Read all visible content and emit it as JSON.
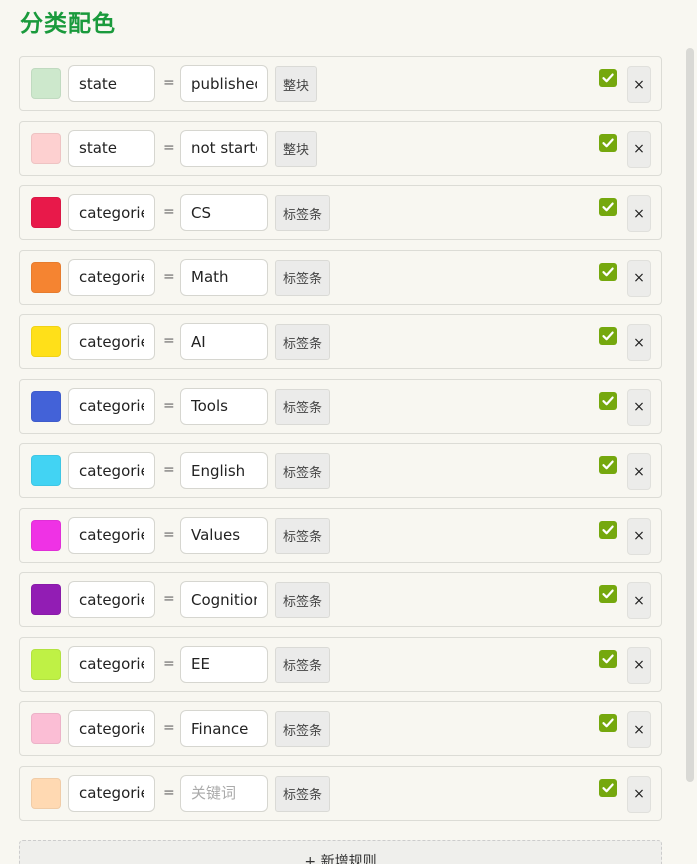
{
  "header": {
    "title": "分类配色"
  },
  "rules": [
    {
      "color": "#cde8cc",
      "key": "state",
      "value": "published",
      "placeholder": "",
      "mode": "整块",
      "enabled": true
    },
    {
      "color": "#fdd0d0",
      "key": "state",
      "value": "not started",
      "placeholder": "",
      "mode": "整块",
      "enabled": true
    },
    {
      "color": "#e8194a",
      "key": "categories",
      "value": "CS",
      "placeholder": "",
      "mode": "标签条",
      "enabled": true
    },
    {
      "color": "#f58431",
      "key": "categories",
      "value": "Math",
      "placeholder": "",
      "mode": "标签条",
      "enabled": true
    },
    {
      "color": "#ffe019",
      "key": "categories",
      "value": "AI",
      "placeholder": "",
      "mode": "标签条",
      "enabled": true
    },
    {
      "color": "#4362d8",
      "key": "categories",
      "value": "Tools",
      "placeholder": "",
      "mode": "标签条",
      "enabled": true
    },
    {
      "color": "#42d3f3",
      "key": "categories",
      "value": "English",
      "placeholder": "",
      "mode": "标签条",
      "enabled": true
    },
    {
      "color": "#ef32e5",
      "key": "categories",
      "value": "Values",
      "placeholder": "",
      "mode": "标签条",
      "enabled": true
    },
    {
      "color": "#921db4",
      "key": "categories",
      "value": "Cognition",
      "placeholder": "",
      "mode": "标签条",
      "enabled": true
    },
    {
      "color": "#bff145",
      "key": "categories",
      "value": "EE",
      "placeholder": "",
      "mode": "标签条",
      "enabled": true
    },
    {
      "color": "#fbbed5",
      "key": "categories",
      "value": "Finance",
      "placeholder": "",
      "mode": "标签条",
      "enabled": true
    },
    {
      "color": "#ffd9b2",
      "key": "categories",
      "value": "",
      "placeholder": "关键词",
      "mode": "标签条",
      "enabled": true
    }
  ],
  "operator": "=",
  "delete_label": "×",
  "add_rule_label": "+ 新增规则",
  "icons": {
    "enabled": "checkbox-checked-icon",
    "delete": "close-icon"
  },
  "accent": "#1a9a3c",
  "check_color": "#75a80e"
}
